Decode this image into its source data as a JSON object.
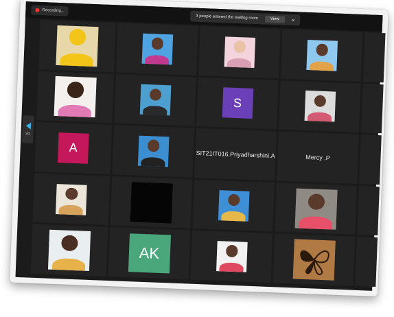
{
  "recording": {
    "label": "Recording..."
  },
  "waiting_notice": {
    "text": "3 people entered the waiting room",
    "view_label": "View",
    "close_glyph": "×"
  },
  "pager": {
    "page": "3/3"
  },
  "avatars": {
    "s": {
      "letter": "S",
      "color": "#6b3fb8"
    },
    "a": {
      "letter": "A",
      "color": "#c4185a"
    },
    "ak": {
      "letter": "AK",
      "color": "#4aa77c"
    }
  },
  "names": {
    "priya": "SIT21IT016.Priyadharshini.A",
    "mercy": "Mercy .P"
  }
}
